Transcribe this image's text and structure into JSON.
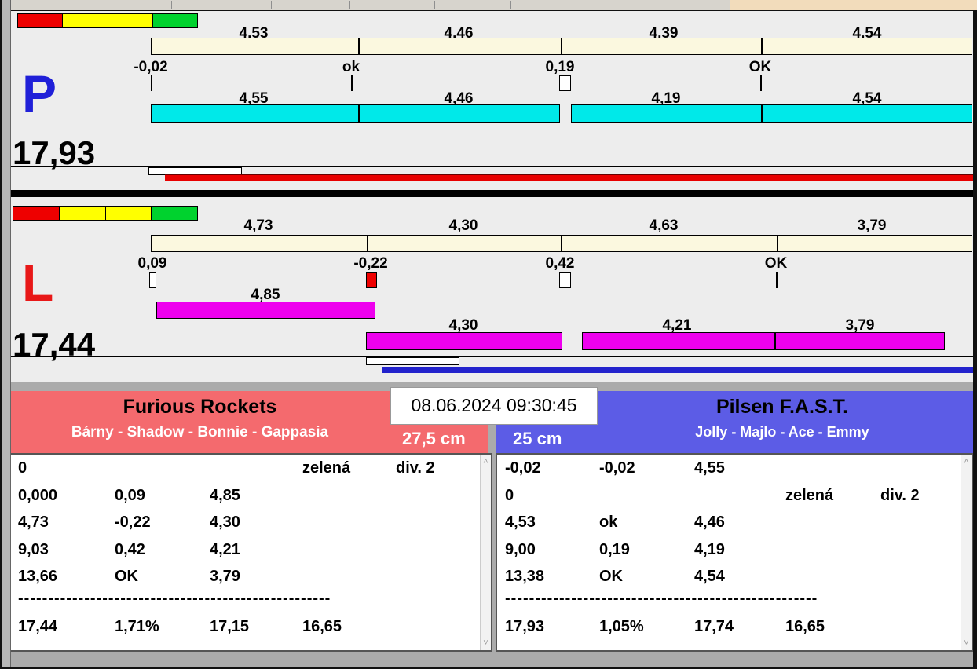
{
  "colors": {
    "traffic_strip": [
      "#EE0000",
      "#FFFF00",
      "#FFFF00",
      "#00D22E"
    ],
    "lane_p_letter": "#2020D8",
    "lane_l_letter": "#E81818",
    "split_bar_top": "#FBF8DF",
    "split_bar_p": "#00E9E9",
    "split_bar_l": "#EE00EE",
    "progress_p": "#E80000",
    "progress_l": "#2222CC",
    "team_left_bg": "#F46A6E",
    "team_right_bg": "#5C5CE6"
  },
  "lanes": {
    "p": {
      "letter": "P",
      "total": "17,93",
      "splits_top": [
        "4,53",
        "4,46",
        "4,39",
        "4,54"
      ],
      "marks": [
        "-0,02",
        "ok",
        "0,19",
        "OK"
      ],
      "splits_bottom": [
        "4,55",
        "4,46",
        "4,19",
        "4,54"
      ]
    },
    "l": {
      "letter": "L",
      "total": "17,44",
      "splits_top": [
        "4,73",
        "4,30",
        "4,63",
        "3,79"
      ],
      "marks": [
        "0,09",
        "-0,22",
        "0,42",
        "OK"
      ],
      "first_split": "4,85",
      "splits_bottom": [
        "4,30",
        "4,21",
        "3,79"
      ]
    }
  },
  "scoreboard": {
    "datetime": "08.06.2024 09:30:45",
    "left": {
      "team": "Furious Rockets",
      "dogs": "Bárny - Shadow - Bonnie - Gappasia",
      "height": "27,5 cm",
      "rows": [
        [
          "0",
          "",
          "",
          "zelená",
          "div. 2"
        ],
        [
          "0,000",
          "0,09",
          "4,85",
          "",
          ""
        ],
        [
          "4,73",
          "-0,22",
          "4,30",
          "",
          ""
        ],
        [
          "9,03",
          "0,42",
          "4,21",
          "",
          ""
        ],
        [
          "13,66",
          "OK",
          "3,79",
          "",
          ""
        ]
      ],
      "dashes": "----------------------------------------------------",
      "totals": [
        "17,44",
        "1,71%",
        "17,15",
        "16,65"
      ]
    },
    "right": {
      "team": "Pilsen F.A.S.T.",
      "dogs": "Jolly - Majlo - Ace - Emmy",
      "height": "25 cm",
      "rows": [
        [
          "-0,02",
          "-0,02",
          "4,55",
          "",
          ""
        ],
        [
          "0",
          "",
          "",
          "zelená",
          "div. 2"
        ],
        [
          "4,53",
          "ok",
          "4,46",
          "",
          ""
        ],
        [
          "9,00",
          "0,19",
          "4,19",
          "",
          ""
        ],
        [
          "13,38",
          "OK",
          "4,54",
          "",
          ""
        ]
      ],
      "dashes": "----------------------------------------------------",
      "totals": [
        "17,93",
        "1,05%",
        "17,74",
        "16,65"
      ]
    },
    "scroll_up_glyph": "˄",
    "scroll_down_glyph": "˅"
  }
}
